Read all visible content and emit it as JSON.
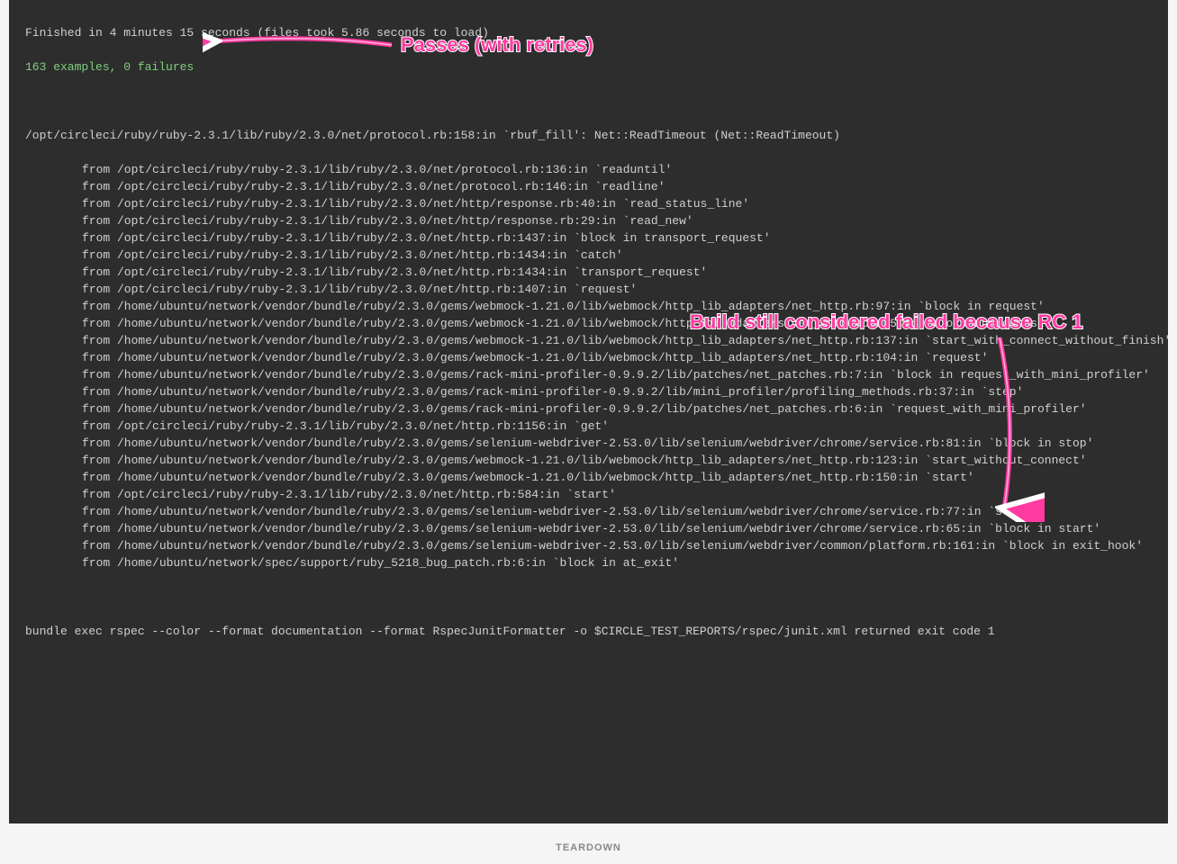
{
  "colors": {
    "terminal_bg": "#2d2d2d",
    "terminal_fg": "#d0d0d0",
    "success_green": "#7fcf7f",
    "annotation_pink": "#ff3aa0"
  },
  "terminal": {
    "finished_line": "Finished in 4 minutes 15 seconds (files took 5.86 seconds to load)",
    "summary_line": "163 examples, 0 failures",
    "error_header": "/opt/circleci/ruby/ruby-2.3.1/lib/ruby/2.3.0/net/protocol.rb:158:in `rbuf_fill': Net::ReadTimeout (Net::ReadTimeout)",
    "stack": [
      "from /opt/circleci/ruby/ruby-2.3.1/lib/ruby/2.3.0/net/protocol.rb:136:in `readuntil'",
      "from /opt/circleci/ruby/ruby-2.3.1/lib/ruby/2.3.0/net/protocol.rb:146:in `readline'",
      "from /opt/circleci/ruby/ruby-2.3.1/lib/ruby/2.3.0/net/http/response.rb:40:in `read_status_line'",
      "from /opt/circleci/ruby/ruby-2.3.1/lib/ruby/2.3.0/net/http/response.rb:29:in `read_new'",
      "from /opt/circleci/ruby/ruby-2.3.1/lib/ruby/2.3.0/net/http.rb:1437:in `block in transport_request'",
      "from /opt/circleci/ruby/ruby-2.3.1/lib/ruby/2.3.0/net/http.rb:1434:in `catch'",
      "from /opt/circleci/ruby/ruby-2.3.1/lib/ruby/2.3.0/net/http.rb:1434:in `transport_request'",
      "from /opt/circleci/ruby/ruby-2.3.1/lib/ruby/2.3.0/net/http.rb:1407:in `request'",
      "from /home/ubuntu/network/vendor/bundle/ruby/2.3.0/gems/webmock-1.21.0/lib/webmock/http_lib_adapters/net_http.rb:97:in `block in request'",
      "from /home/ubuntu/network/vendor/bundle/ruby/2.3.0/gems/webmock-1.21.0/lib/webmock/http_lib_adapters/net_http.rb:105:in `block in request'",
      "from /home/ubuntu/network/vendor/bundle/ruby/2.3.0/gems/webmock-1.21.0/lib/webmock/http_lib_adapters/net_http.rb:137:in `start_with_connect_without_finish'",
      "from /home/ubuntu/network/vendor/bundle/ruby/2.3.0/gems/webmock-1.21.0/lib/webmock/http_lib_adapters/net_http.rb:104:in `request'",
      "from /home/ubuntu/network/vendor/bundle/ruby/2.3.0/gems/rack-mini-profiler-0.9.9.2/lib/patches/net_patches.rb:7:in `block in request_with_mini_profiler'",
      "from /home/ubuntu/network/vendor/bundle/ruby/2.3.0/gems/rack-mini-profiler-0.9.9.2/lib/mini_profiler/profiling_methods.rb:37:in `step'",
      "from /home/ubuntu/network/vendor/bundle/ruby/2.3.0/gems/rack-mini-profiler-0.9.9.2/lib/patches/net_patches.rb:6:in `request_with_mini_profiler'",
      "from /opt/circleci/ruby/ruby-2.3.1/lib/ruby/2.3.0/net/http.rb:1156:in `get'",
      "from /home/ubuntu/network/vendor/bundle/ruby/2.3.0/gems/selenium-webdriver-2.53.0/lib/selenium/webdriver/chrome/service.rb:81:in `block in stop'",
      "from /home/ubuntu/network/vendor/bundle/ruby/2.3.0/gems/webmock-1.21.0/lib/webmock/http_lib_adapters/net_http.rb:123:in `start_without_connect'",
      "from /home/ubuntu/network/vendor/bundle/ruby/2.3.0/gems/webmock-1.21.0/lib/webmock/http_lib_adapters/net_http.rb:150:in `start'",
      "from /opt/circleci/ruby/ruby-2.3.1/lib/ruby/2.3.0/net/http.rb:584:in `start'",
      "from /home/ubuntu/network/vendor/bundle/ruby/2.3.0/gems/selenium-webdriver-2.53.0/lib/selenium/webdriver/chrome/service.rb:77:in `stop'",
      "from /home/ubuntu/network/vendor/bundle/ruby/2.3.0/gems/selenium-webdriver-2.53.0/lib/selenium/webdriver/chrome/service.rb:65:in `block in start'",
      "from /home/ubuntu/network/vendor/bundle/ruby/2.3.0/gems/selenium-webdriver-2.53.0/lib/selenium/webdriver/common/platform.rb:161:in `block in exit_hook'",
      "from /home/ubuntu/network/spec/support/ruby_5218_bug_patch.rb:6:in `block in at_exit'"
    ],
    "exit_line": "bundle exec rspec --color --format documentation --format RspecJunitFormatter -o $CIRCLE_TEST_REPORTS/rspec/junit.xml returned exit code 1"
  },
  "annotations": {
    "passes": "Passes (with retries)",
    "failed": "Build still considered failed because RC 1"
  },
  "footer": {
    "label": "TEARDOWN"
  }
}
